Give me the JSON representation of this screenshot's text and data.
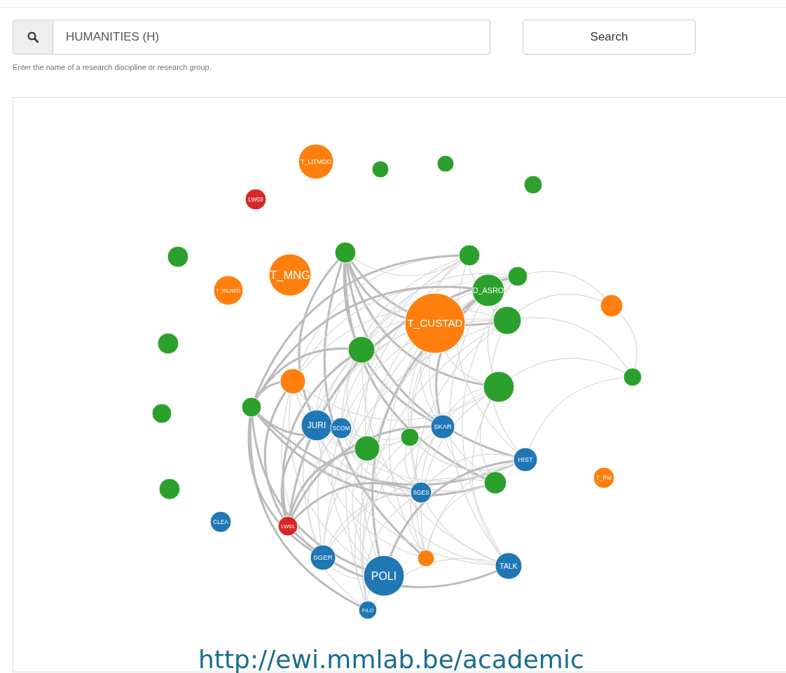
{
  "search": {
    "value": "HUMANITIES (H)",
    "button": "Search",
    "help": "Enter the name of a research discipline or research group."
  },
  "graph": {
    "nodes": [
      {
        "label": "T_LITMOD",
        "color": "#ff7f0e"
      },
      {
        "color": "#2ca02c"
      },
      {
        "color": "#2ca02c"
      },
      {
        "color": "#2ca02c"
      },
      {
        "label": "LW03",
        "color": "#d62728"
      },
      {
        "color": "#2ca02c"
      },
      {
        "color": "#2ca02c"
      },
      {
        "color": "#2ca02c"
      },
      {
        "label": "T_MNG",
        "color": "#ff7f0e"
      },
      {
        "label": "T_ISLNED",
        "color": "#ff7f0e"
      },
      {
        "color": "#2ca02c"
      },
      {
        "label": "D_ASRO",
        "color": "#2ca02c"
      },
      {
        "color": "#ff7f0e"
      },
      {
        "label": "T_CUSTAD",
        "color": "#ff7f0e"
      },
      {
        "color": "#2ca02c"
      },
      {
        "color": "#2ca02c"
      },
      {
        "color": "#2ca02c"
      },
      {
        "color": "#ff7f0e"
      },
      {
        "color": "#2ca02c"
      },
      {
        "color": "#2ca02c"
      },
      {
        "color": "#2ca02c"
      },
      {
        "color": "#2ca02c"
      },
      {
        "label": "JURI",
        "color": "#1f77b4"
      },
      {
        "label": "SCOM",
        "color": "#1f77b4"
      },
      {
        "label": "SKAR",
        "color": "#1f77b4"
      },
      {
        "color": "#2ca02c"
      },
      {
        "color": "#2ca02c"
      },
      {
        "label": "HIST",
        "color": "#1f77b4"
      },
      {
        "label": "T_PM",
        "color": "#ff7f0e"
      },
      {
        "color": "#2ca02c"
      },
      {
        "label": "SGES",
        "color": "#1f77b4"
      },
      {
        "color": "#2ca02c"
      },
      {
        "label": "CLEA",
        "color": "#1f77b4"
      },
      {
        "label": "LW01",
        "color": "#d62728"
      },
      {
        "label": "SGER",
        "color": "#1f77b4"
      },
      {
        "color": "#ff7f0e"
      },
      {
        "label": "POLI",
        "color": "#1f77b4"
      },
      {
        "label": "TALK",
        "color": "#1f77b4"
      },
      {
        "label": "FILO",
        "color": "#1f77b4"
      }
    ]
  },
  "caption": "http://ewi.mmlab.be/academic"
}
